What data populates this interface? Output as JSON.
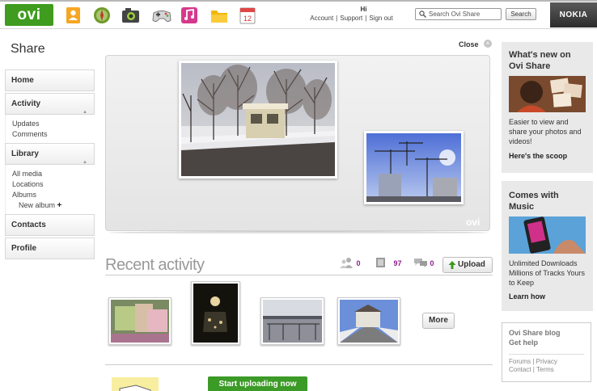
{
  "header": {
    "logo": "ovi",
    "apps": [
      {
        "name": "contacts",
        "color": "#f5a623"
      },
      {
        "name": "maps",
        "color": "#6e9a2a"
      },
      {
        "name": "camera",
        "color": "#333333"
      },
      {
        "name": "games",
        "color": "#cfcfcf"
      },
      {
        "name": "music",
        "color": "#d6398c"
      },
      {
        "name": "files",
        "color": "#f2b705"
      },
      {
        "name": "calendar",
        "color": "#e04646"
      }
    ],
    "calendar_day": "12",
    "greeting": "Hi",
    "links": [
      "Account",
      "Support",
      "Sign out"
    ],
    "search_placeholder": "Search Ovi Share",
    "search_button": "Search",
    "brand": "NOKIA"
  },
  "sidebar": {
    "title": "Share",
    "home": "Home",
    "activity": "Activity",
    "activity_items": [
      "Updates",
      "Comments"
    ],
    "library": "Library",
    "library_items": [
      "All media",
      "Locations",
      "Albums"
    ],
    "new_album": "New album",
    "contacts": "Contacts",
    "profile": "Profile"
  },
  "showcase": {
    "close_label": "Close",
    "watermark": "ovi"
  },
  "recent": {
    "title": "Recent activity",
    "contacts_count": "0",
    "media_count": "97",
    "comments_count": "0",
    "upload_label": "Upload",
    "more_label": "More",
    "start_label": "Start uploading now"
  },
  "right": {
    "whatsnew_title": "What's new on Ovi Share",
    "whatsnew_text": "Easier to view and share your photos and videos!",
    "whatsnew_link": "Here's the scoop",
    "music_title": "Comes with Music",
    "music_text": "Unlimited Downloads Millions of Tracks Yours to Keep",
    "music_link": "Learn how",
    "blog_title": "Ovi Share blog",
    "help_title": "Get help",
    "footer1": "Forums | Privacy",
    "footer2": "Contact | Terms"
  }
}
